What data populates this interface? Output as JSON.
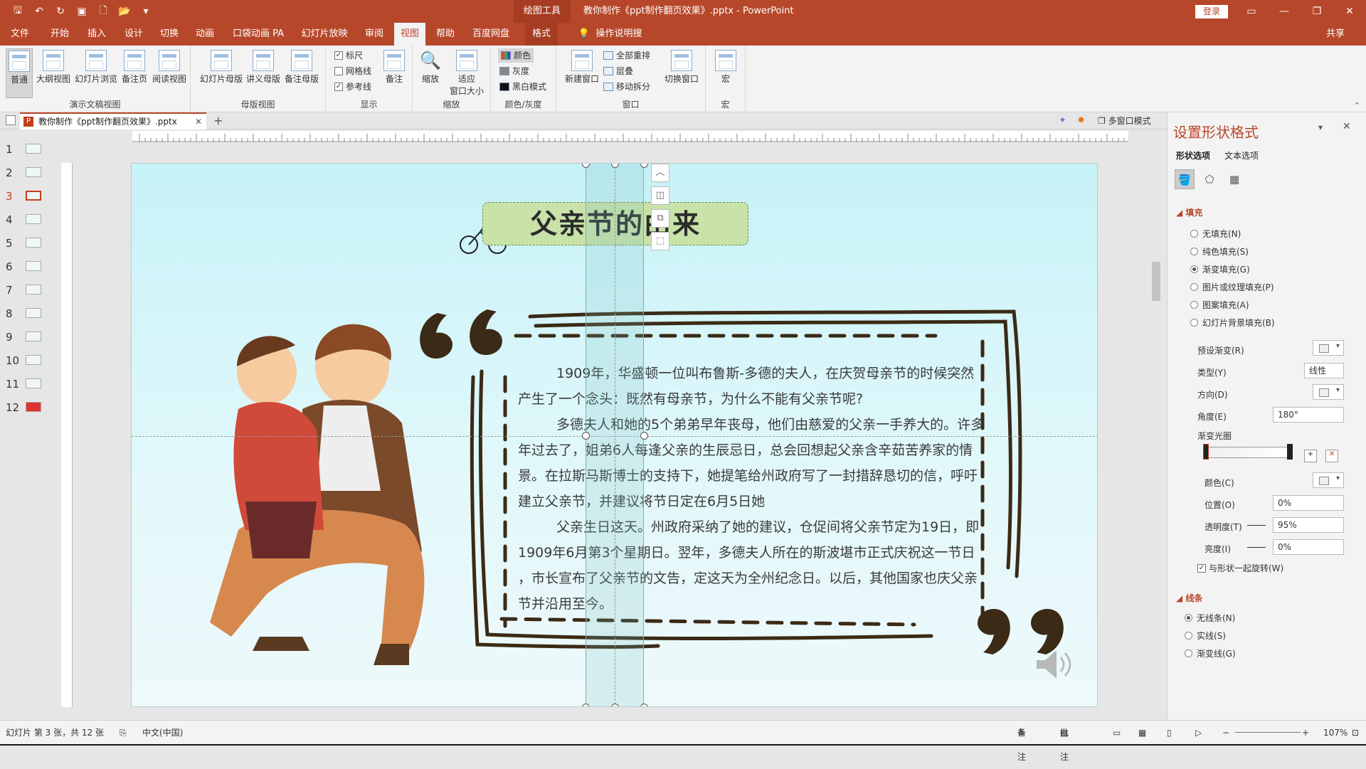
{
  "titlebar": {
    "draw_tools": "绘图工具",
    "doc_title": "教你制作《ppt制作翻页效果》.pptx  -  PowerPoint",
    "login": "登录"
  },
  "tabs": [
    "文件",
    "开始",
    "插入",
    "设计",
    "切换",
    "动画",
    "口袋动画 PA",
    "幻灯片放映",
    "审阅",
    "视图",
    "帮助",
    "百度网盘",
    "格式"
  ],
  "active_tab": "视图",
  "tell_me": "操作说明搜索",
  "share": "共享",
  "ribbon": {
    "groups": {
      "presentation_views": "演示文稿视图",
      "master_views": "母版视图",
      "show": "显示",
      "zoom": "缩放",
      "color_gray": "颜色/灰度",
      "window": "窗口",
      "macros": "宏"
    },
    "presentation_views": [
      "普通",
      "大纲视图",
      "幻灯片浏览",
      "备注页",
      "阅读视图"
    ],
    "master_views": [
      "幻灯片母版",
      "讲义母版",
      "备注母版"
    ],
    "show": {
      "ruler": "标尺",
      "gridlines": "网格线",
      "guides": "参考线",
      "notes": "备注"
    },
    "zoom": {
      "zoom": "缩放",
      "fit_line1": "适应",
      "fit_line2": "窗口大小"
    },
    "color": {
      "color": "颜色",
      "gray": "灰度",
      "bw": "黑白模式"
    },
    "window": {
      "new_window": "新建窗口",
      "arrange_all": "全部重排",
      "cascade": "层叠",
      "move_split": "移动拆分",
      "switch": "切换窗口"
    },
    "macro": "宏"
  },
  "doc_tab": "教你制作《ppt制作翻页效果》.pptx",
  "multi_window": "多窗口模式",
  "slides": [
    "1",
    "2",
    "3",
    "4",
    "5",
    "6",
    "7",
    "8",
    "9",
    "10",
    "11",
    "12"
  ],
  "current_slide": 3,
  "slide": {
    "title": "父亲节的由来",
    "paragraphs": [
      "1909年，华盛顿一位叫布鲁斯-多德的夫人，在庆贺母亲节的时候突然产生了一个念头：既然有母亲节，为什么不能有父亲节呢?",
      "多德夫人和她的5个弟弟早年丧母，他们由慈爱的父亲一手养大的。许多年过去了，姐弟6人每逢父亲的生辰忌日，总会回想起父亲含辛茹苦养家的情景。在拉斯马斯博士的支持下，她提笔给州政府写了一封措辞恳切的信，呼吁建立父亲节，并建议将节日定在6月5日她",
      "父亲生日这天。州政府采纳了她的建议，仓促间将父亲节定为19日，即1909年6月第3个星期日。翌年，多德夫人所在的斯波堪市正式庆祝这一节日 ，市长宣布了父亲节的文告，定这天为全州纪念日。以后，其他国家也庆父亲节并沿用至今。"
    ]
  },
  "panel": {
    "title": "设置形状格式",
    "tabs": [
      "形状选项",
      "文本选项"
    ],
    "fill_section": "填充",
    "fill_options": [
      "无填充(N)",
      "纯色填充(S)",
      "渐变填充(G)",
      "图片或纹理填充(P)",
      "图案填充(A)",
      "幻灯片背景填充(B)"
    ],
    "fill_selected": 2,
    "preset": "预设渐变(R)",
    "type_label": "类型(Y)",
    "type_value": "线性",
    "direction": "方向(D)",
    "angle_label": "角度(E)",
    "angle_value": "180°",
    "stops_label": "渐变光圈",
    "color_label": "颜色(C)",
    "position_label": "位置(O)",
    "position_value": "0%",
    "transparency_label": "透明度(T)",
    "transparency_value": "95%",
    "brightness_label": "亮度(I)",
    "brightness_value": "0%",
    "rotate_with": "与形状一起旋转(W)",
    "line_section": "线条",
    "line_options": [
      "无线条(N)",
      "实线(S)",
      "渐变线(G)"
    ],
    "line_selected": 0
  },
  "status": {
    "slide_info": "幻灯片 第 3 张，共 12 张",
    "language": "中文(中国)",
    "notes": "备注",
    "comments": "批注",
    "zoom": "107%"
  },
  "colors": {
    "accent": "#b7472a",
    "slide_bg": "#c6f2f8",
    "title_box": "#c8e2a8"
  }
}
